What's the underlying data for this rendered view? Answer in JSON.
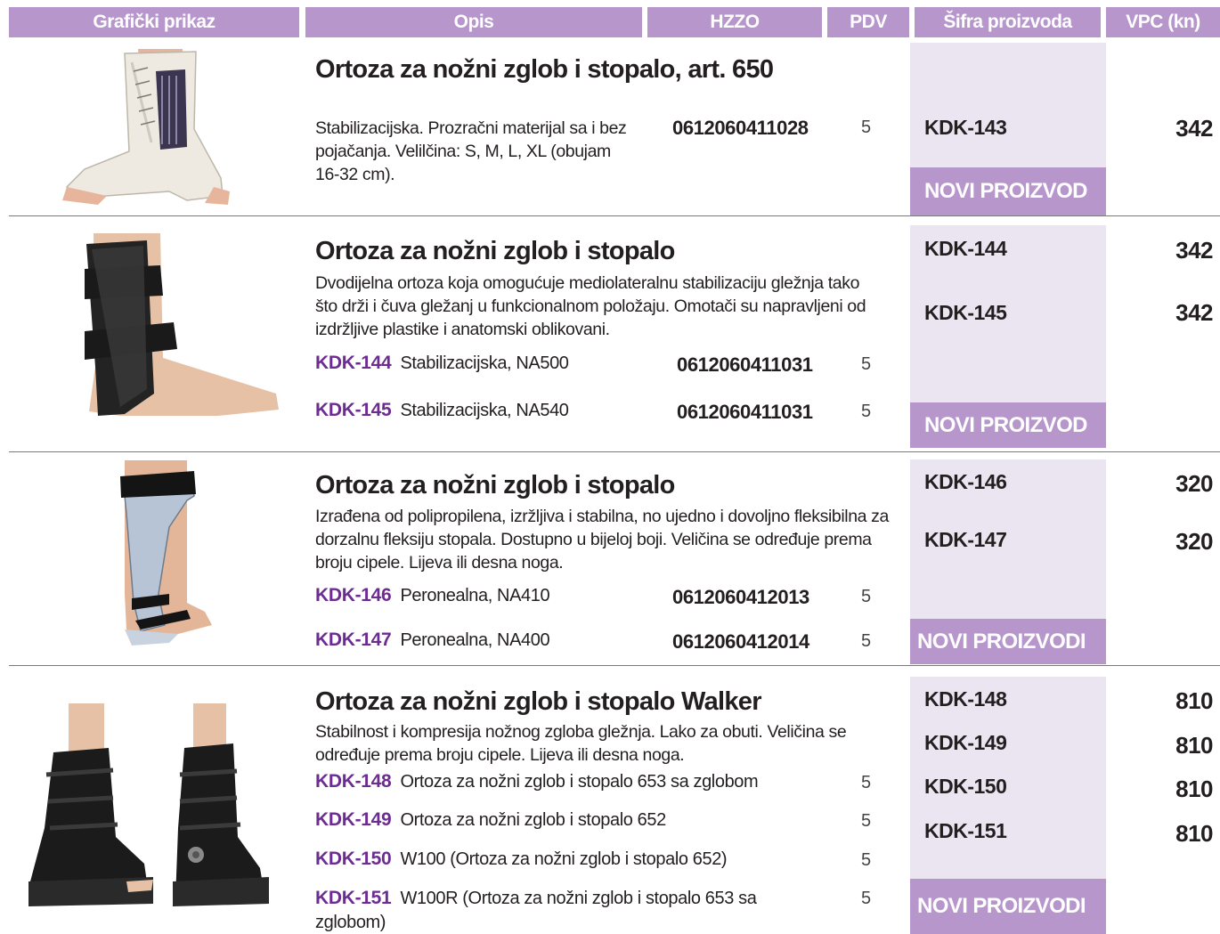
{
  "headers": {
    "image": "Grafički prikaz",
    "desc": "Opis",
    "hzzo": "HZZO",
    "pdv": "PDV",
    "code": "Šifra proizvoda",
    "price": "VPC (kn)"
  },
  "colors": {
    "accent": "#b796cc",
    "code_bg": "#ebe5f1",
    "sub_code": "#6c2c91"
  },
  "products": [
    {
      "title": "Ortoza za nožni zglob i stopalo, art. 650",
      "desc": "Stabilizacijska. Prozračni materijal sa i bez pojačanja. Velilčina: S, M, L, XL (obujam 16-32 cm).",
      "hzzo": "0612060411028",
      "pdv": "5",
      "codes": [
        {
          "code": "KDK-143",
          "price": "342"
        }
      ],
      "badge": "NOVI PROIZVOD"
    },
    {
      "title": "Ortoza za nožni zglob i stopalo",
      "desc": "Dvodijelna ortoza koja omogućuje mediolateralnu stabilizaciju gležnja tako što drži i čuva gležanj u funkcionalnom položaju. Omotači su napravljeni od izdržljive plastike i anatomski oblikovani.",
      "variants": [
        {
          "code": "KDK-144",
          "label": "Stabilizacijska, NA500",
          "hzzo": "0612060411031",
          "pdv": "5"
        },
        {
          "code": "KDK-145",
          "label": "Stabilizacijska, NA540",
          "hzzo": "0612060411031",
          "pdv": "5"
        }
      ],
      "codes": [
        {
          "code": "KDK-144",
          "price": "342"
        },
        {
          "code": "KDK-145",
          "price": "342"
        }
      ],
      "badge": "NOVI PROIZVOD"
    },
    {
      "title": "Ortoza za nožni zglob i stopalo",
      "desc": "Izrađena od polipropilena, izržljiva i stabilna, no ujedno i dovoljno fleksibilna za dorzalnu fleksiju stopala. Dostupno u bijeloj boji. Veličina se određuje prema broju cipele. Lijeva ili desna noga.",
      "variants": [
        {
          "code": "KDK-146",
          "label": "Peronealna, NA410",
          "hzzo": "0612060412013",
          "pdv": "5"
        },
        {
          "code": "KDK-147",
          "label": "Peronealna, NA400",
          "hzzo": "0612060412014",
          "pdv": "5"
        }
      ],
      "codes": [
        {
          "code": "KDK-146",
          "price": "320"
        },
        {
          "code": "KDK-147",
          "price": "320"
        }
      ],
      "badge": "NOVI PROIZVODI"
    },
    {
      "title": "Ortoza za nožni zglob i stopalo Walker",
      "desc": "Stabilnost i kompresija nožnog zgloba gležnja. Lako za obuti. Veličina se određuje prema broju cipele. Lijeva ili desna noga.",
      "variants": [
        {
          "code": "KDK-148",
          "label": "Ortoza za nožni zglob i stopalo 653 sa zglobom",
          "pdv": "5"
        },
        {
          "code": "KDK-149",
          "label": "Ortoza za nožni zglob i stopalo 652",
          "pdv": "5"
        },
        {
          "code": "KDK-150",
          "label": "W100 (Ortoza za nožni zglob i stopalo 652)",
          "pdv": "5"
        },
        {
          "code": "KDK-151",
          "label": "W100R (Ortoza za nožni zglob i stopalo 653 sa",
          "label2": "zglobom)",
          "pdv": "5"
        }
      ],
      "codes": [
        {
          "code": "KDK-148",
          "price": "810"
        },
        {
          "code": "KDK-149",
          "price": "810"
        },
        {
          "code": "KDK-150",
          "price": "810"
        },
        {
          "code": "KDK-151",
          "price": "810"
        }
      ],
      "badge": "NOVI PROIZVODI"
    }
  ]
}
